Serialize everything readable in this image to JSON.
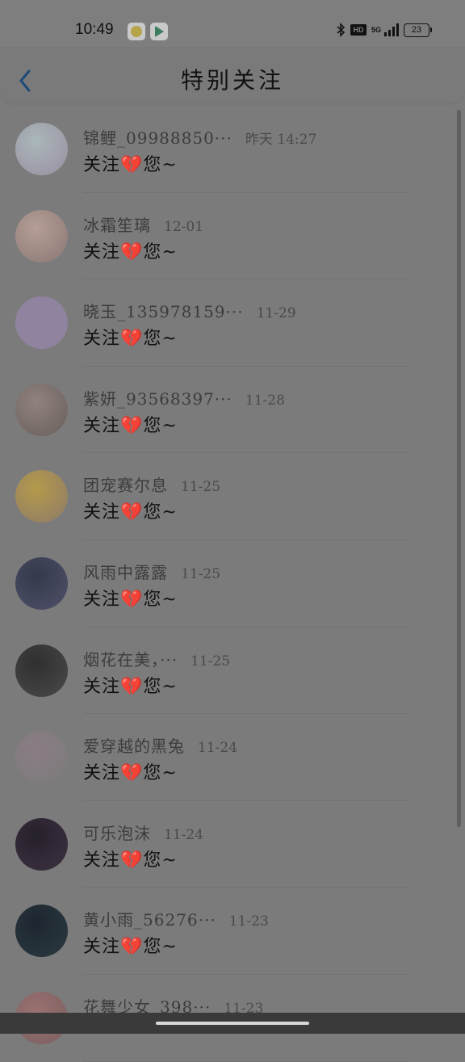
{
  "status_bar": {
    "time": "10:49",
    "network": "5G",
    "hd": "HD",
    "battery": "23"
  },
  "header": {
    "title": "特别关注"
  },
  "items": [
    {
      "name": "锦鲤_09988850···",
      "date": "昨天 14:27",
      "message": "关注💔您~",
      "avatar_colors": [
        "#a9b7b9",
        "#9a8fa1"
      ]
    },
    {
      "name": "冰霜笙璃",
      "date": "12-01",
      "message": "关注💔您~",
      "avatar_colors": [
        "#b59e97",
        "#8a7773"
      ]
    },
    {
      "name": "晓玉_135978159···",
      "date": "11-29",
      "message": "关注💔您~",
      "avatar_colors": [
        "#8f83a0",
        "#8f83a0"
      ]
    },
    {
      "name": "紫妍_93568397···",
      "date": "11-28",
      "message": "关注💔您~",
      "avatar_colors": [
        "#8f827f",
        "#6a5f5c"
      ]
    },
    {
      "name": "团宠赛尔息",
      "date": "11-25",
      "message": "关注💔您~",
      "avatar_colors": [
        "#b49a4a",
        "#8d7a6a"
      ]
    },
    {
      "name": "风雨中露露",
      "date": "11-25",
      "message": "关注💔您~",
      "avatar_colors": [
        "#333a4a",
        "#50506a"
      ]
    },
    {
      "name": "烟花在美，···",
      "date": "11-25",
      "message": "关注💔您~",
      "avatar_colors": [
        "#2f2f2f",
        "#4a4a4a"
      ]
    },
    {
      "name": "爱穿越的黑兔",
      "date": "11-24",
      "message": "关注💔您~",
      "avatar_colors": [
        "#8a7d85",
        "#7b7b7b"
      ]
    },
    {
      "name": "可乐泡沫",
      "date": "11-24",
      "message": "关注💔您~",
      "avatar_colors": [
        "#26212b",
        "#3d3242"
      ]
    },
    {
      "name": "黄小雨_56276···",
      "date": "11-23",
      "message": "关注💔您~",
      "avatar_colors": [
        "#1d2630",
        "#2b3a40"
      ]
    },
    {
      "name": "花舞少女_398···",
      "date": "11-23",
      "message": "",
      "avatar_colors": [
        "#9a7070",
        "#7b6060"
      ]
    }
  ]
}
